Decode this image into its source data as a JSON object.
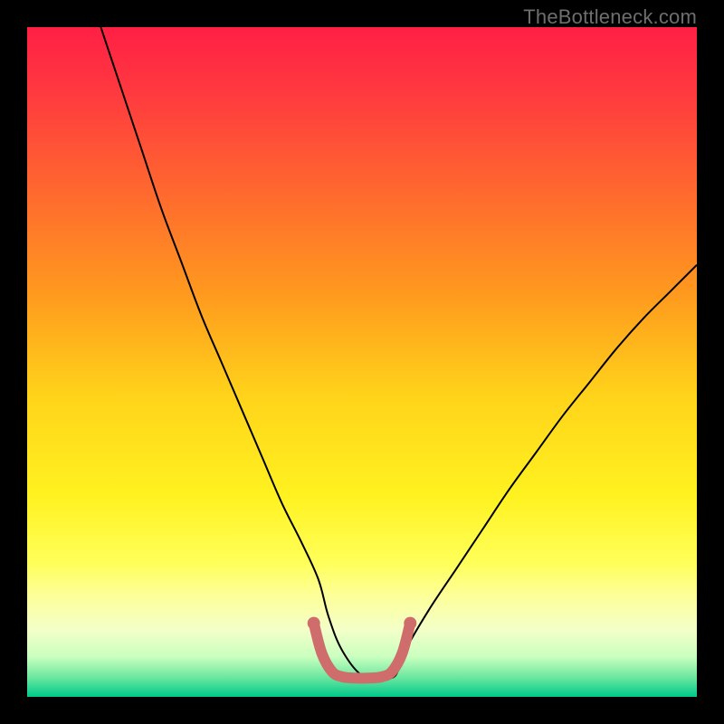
{
  "watermark": "TheBottleneck.com",
  "chart_data": {
    "type": "line",
    "title": "",
    "xlabel": "",
    "ylabel": "",
    "xlim": [
      0,
      100
    ],
    "ylim": [
      0,
      100
    ],
    "background_gradient_stops": [
      {
        "offset": 0.0,
        "color": "#ff1f45"
      },
      {
        "offset": 0.1,
        "color": "#ff3a3f"
      },
      {
        "offset": 0.25,
        "color": "#ff6a2e"
      },
      {
        "offset": 0.4,
        "color": "#ff9a1e"
      },
      {
        "offset": 0.55,
        "color": "#ffd31a"
      },
      {
        "offset": 0.7,
        "color": "#fff220"
      },
      {
        "offset": 0.8,
        "color": "#ffff5a"
      },
      {
        "offset": 0.85,
        "color": "#fdff9a"
      },
      {
        "offset": 0.9,
        "color": "#f3ffc8"
      },
      {
        "offset": 0.94,
        "color": "#caffc0"
      },
      {
        "offset": 0.97,
        "color": "#6fe8a0"
      },
      {
        "offset": 1.0,
        "color": "#00c98b"
      }
    ],
    "series": [
      {
        "name": "bottleneck-curve",
        "stroke": "#000000",
        "stroke_width": 2,
        "x": [
          11,
          14,
          17,
          20,
          23,
          26,
          29,
          32,
          35,
          38,
          41,
          43.5,
          45,
          47,
          50,
          53,
          55,
          56.5,
          60,
          64,
          68,
          72,
          76,
          80,
          84,
          88,
          92,
          96,
          100
        ],
        "y": [
          100,
          91,
          82,
          73,
          65,
          57,
          50,
          43,
          36,
          29,
          23,
          17.5,
          12,
          7,
          3.2,
          3.0,
          3.2,
          7,
          13,
          19,
          25,
          31,
          36.5,
          42,
          47,
          52,
          56.5,
          60.5,
          64.5
        ]
      },
      {
        "name": "valley-highlight",
        "stroke": "#cf6d6d",
        "stroke_width": 12,
        "cap": "round",
        "x": [
          42.8,
          44.0,
          45.5,
          47.0,
          49.0,
          51.0,
          53.0,
          54.5,
          56.0,
          57.2
        ],
        "y": [
          11.0,
          6.5,
          3.8,
          3.0,
          2.8,
          2.8,
          3.0,
          3.8,
          6.5,
          11.0
        ]
      }
    ],
    "markers": [
      {
        "name": "valley-marker-left",
        "x": 42.8,
        "y": 11.0,
        "r": 7,
        "fill": "#cf6d6d"
      },
      {
        "name": "valley-marker-right",
        "x": 57.2,
        "y": 11.0,
        "r": 7,
        "fill": "#cf6d6d"
      }
    ]
  }
}
